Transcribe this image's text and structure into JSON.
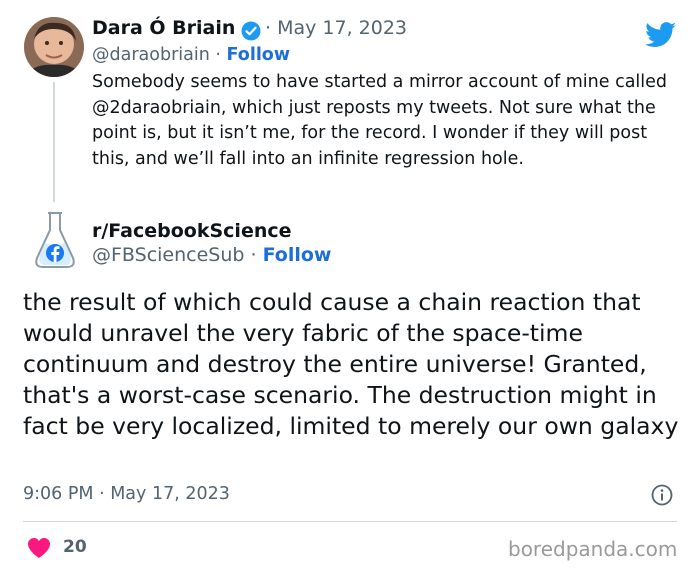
{
  "tweet": {
    "author_name": "Dara Ó Briain",
    "author_handle": "@daraobriain",
    "separator": "·",
    "date": "May 17, 2023",
    "follow_label": "Follow",
    "text": "Somebody seems to have started a mirror account of mine called @2daraobriain, which just reposts my tweets. Not sure what the point is, but it isn’t me, for the record. I wonder if they will post this, and we’ll fall into an infinite regression hole."
  },
  "reply": {
    "author_name": "r/FacebookScience",
    "author_handle": "@FBScienceSub",
    "follow_label": "Follow",
    "text": "the result of which could cause a chain reaction that would unravel the very fabric of the space-time continuum and destroy the entire universe! Granted, that's a worst-case scenario. The destruction might in fact be very localized, limited to merely our own galaxy",
    "timestamp": "9:06 PM · May 17, 2023",
    "like_count": "20"
  },
  "watermark": "boredpanda.com",
  "colors": {
    "follow": "#1d6fd6",
    "verified": "#1d9bf0",
    "twitter_brand": "#1d9bf0",
    "heart": "#f91880",
    "muted": "#536471"
  },
  "icons": [
    "verified-badge-icon",
    "twitter-bird-icon",
    "info-icon",
    "heart-icon",
    "flask-facebook-logo-icon"
  ]
}
